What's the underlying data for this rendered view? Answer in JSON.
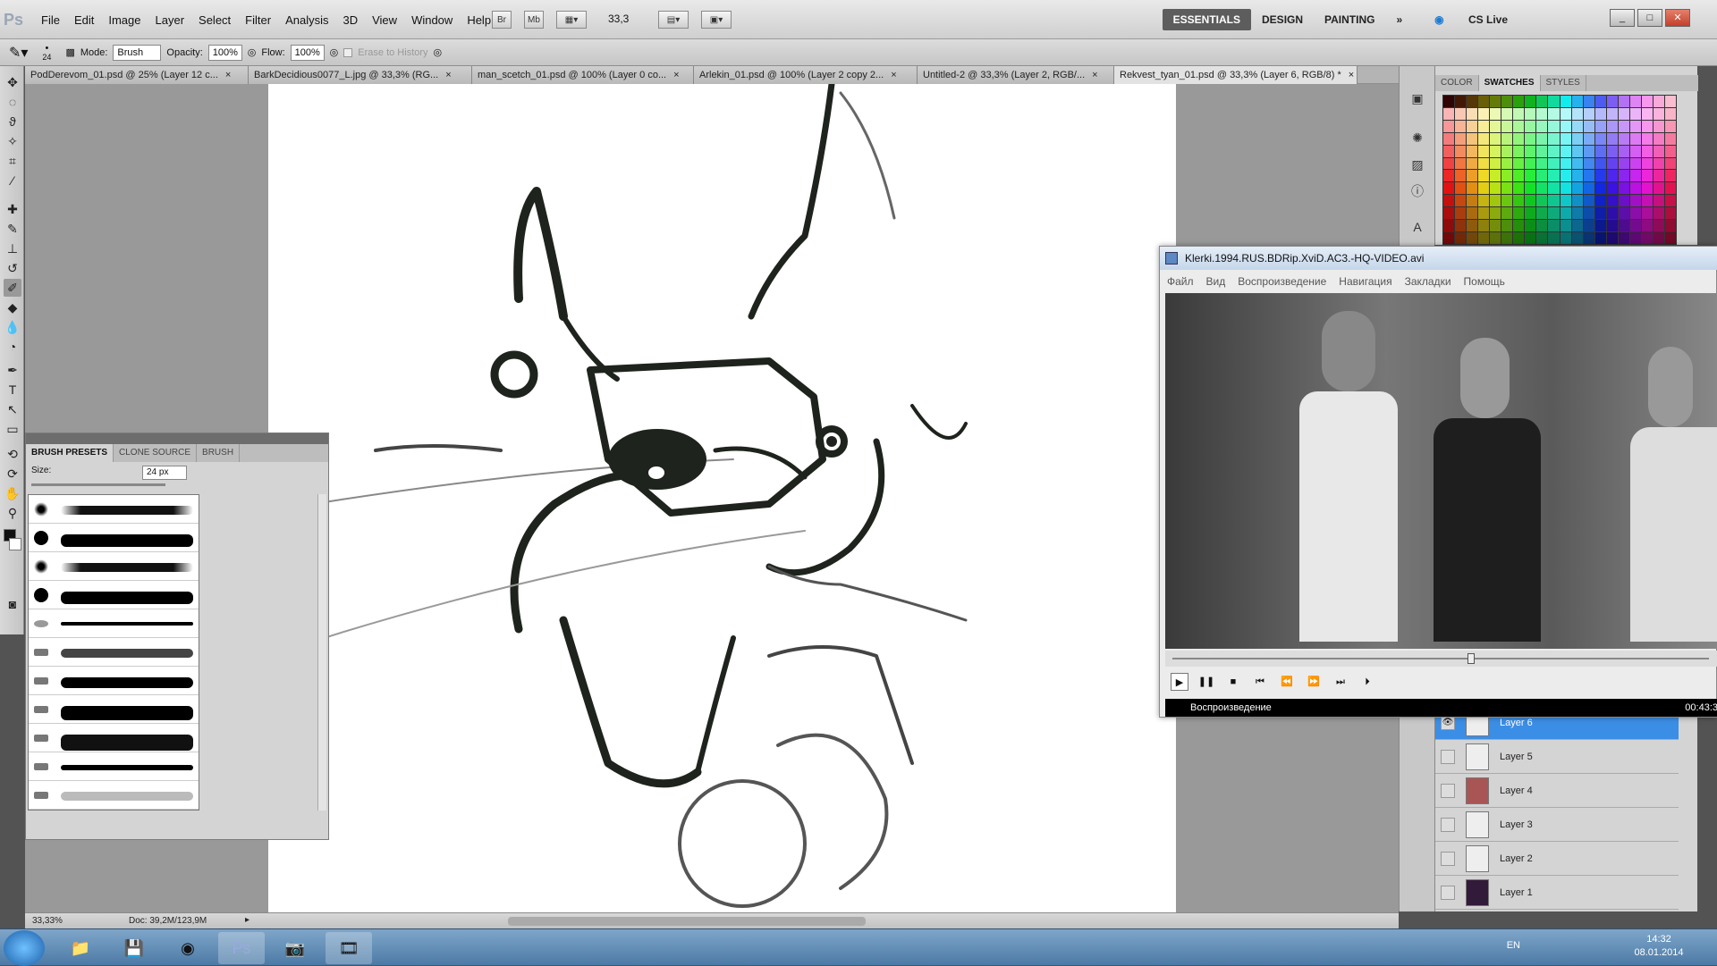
{
  "app": {
    "logo": "Ps"
  },
  "menu": [
    "File",
    "Edit",
    "Image",
    "Layer",
    "Select",
    "Filter",
    "Analysis",
    "3D",
    "View",
    "Window",
    "Help"
  ],
  "toolbar_buttons": {
    "bridge": "Br",
    "minibridge": "Mb",
    "zoom": "33,3"
  },
  "workspaces": [
    "ESSENTIALS",
    "DESIGN",
    "PAINTING"
  ],
  "workspace_more": "»",
  "cslive": "CS Live",
  "options": {
    "brush_size": "24",
    "mode_label": "Mode:",
    "mode_value": "Brush",
    "opacity_label": "Opacity:",
    "opacity_value": "100%",
    "flow_label": "Flow:",
    "flow_value": "100%",
    "erase_history": "Erase to History"
  },
  "tabs": [
    {
      "label": "PodDerevom_01.psd @ 25% (Layer 12 c...",
      "close": "×"
    },
    {
      "label": "BarkDecidious0077_L.jpg @ 33,3% (RG...",
      "close": "×"
    },
    {
      "label": "man_scetch_01.psd @ 100% (Layer 0 co...",
      "close": "×"
    },
    {
      "label": "Arlekin_01.psd @ 100% (Layer 2 copy 2...",
      "close": "×"
    },
    {
      "label": "Untitled-2 @ 33,3% (Layer 2, RGB/...",
      "close": "×"
    },
    {
      "label": "Rekvest_tyan_01.psd @ 33,3% (Layer 6, RGB/8) *",
      "close": "×"
    }
  ],
  "status": {
    "zoom": "33,33%",
    "doc": "Doc: 39,2M/123,9M"
  },
  "brush_panel": {
    "tabs": [
      "BRUSH PRESETS",
      "CLONE SOURCE",
      "BRUSH"
    ],
    "size_label": "Size:",
    "size_value": "24 px"
  },
  "swatch_panel": {
    "tabs": [
      "COLOR",
      "SWATCHES",
      "STYLES"
    ]
  },
  "layers": [
    "Layer 6",
    "Layer 5",
    "Layer 4",
    "Layer 3",
    "Layer 2",
    "Layer 1"
  ],
  "video": {
    "title": "Klerki.1994.RUS.BDRip.XviD.AC3.-HQ-VIDEO.avi",
    "menu": [
      "Файл",
      "Вид",
      "Воспроизведение",
      "Навигация",
      "Закладки",
      "Помощь"
    ],
    "status": "Воспроизведение",
    "time": "00:43:3"
  },
  "taskbar": {
    "lang": "EN",
    "time": "14:32",
    "date": "08.01.2014"
  }
}
